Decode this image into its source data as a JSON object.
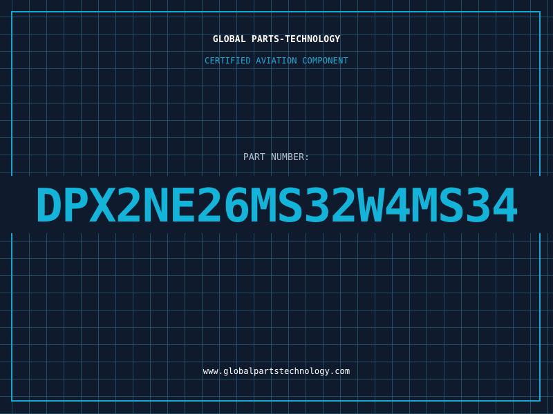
{
  "header": {
    "company_name": "GLOBAL PARTS-TECHNOLOGY",
    "subtitle": "CERTIFIED AVIATION COMPONENT"
  },
  "part": {
    "label": "PART NUMBER:",
    "number": "DPX2NE26MS32W4MS34"
  },
  "footer": {
    "website": "www.globalpartstechnology.com"
  },
  "colors": {
    "background": "#0f1a2d",
    "grid": "#255c78",
    "accent": "#14a8cc",
    "part_number": "#12b5d9",
    "label": "#b6c0cc",
    "text": "#ffffff"
  }
}
